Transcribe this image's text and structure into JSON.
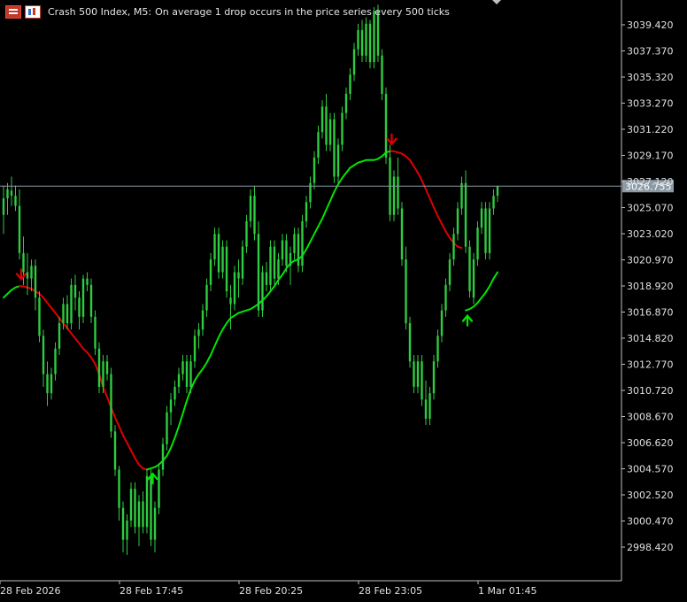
{
  "header": {
    "symbol": "Crash 500 Index, M5:",
    "description": "On average 1 drop occurs in the price series every 500 ticks",
    "icons": [
      "trade-panel-icon",
      "chart-icon"
    ]
  },
  "colors": {
    "background": "#000000",
    "candle": "#2ecc40",
    "ma_up": "#00e600",
    "ma_down": "#e00000",
    "current_price_line": "#8c9aa6",
    "price_label_bg": "#8c9aa6",
    "axis_text": "#e0e0e0",
    "axis_line": "#c0c0c0"
  },
  "chart_data": {
    "type": "candlestick",
    "title": "",
    "xlabel": "",
    "ylabel": "",
    "ylim": [
      2997.0,
      3041.0
    ],
    "y_ticks": [
      "3039.420",
      "3037.370",
      "3035.320",
      "3033.270",
      "3031.220",
      "3029.170",
      "3027.120",
      "3025.070",
      "3023.020",
      "3020.970",
      "3018.920",
      "3016.870",
      "3014.820",
      "3012.770",
      "3010.720",
      "3008.670",
      "3006.620",
      "3004.570",
      "3002.520",
      "3000.470",
      "2998.420"
    ],
    "x_ticks": [
      "28 Feb 2026",
      "28 Feb 17:45",
      "28 Feb 20:25",
      "28 Feb 23:05",
      "1 Mar 01:45"
    ],
    "x_tick_index": [
      0,
      30,
      60,
      90,
      120
    ],
    "current_price": "3026.755",
    "candles": [
      [
        3024.5,
        3026.8,
        3023.0,
        3025.8
      ],
      [
        3025.8,
        3027.0,
        3024.5,
        3026.5
      ],
      [
        3026.4,
        3027.5,
        3025.2,
        3026.0
      ],
      [
        3026.0,
        3026.8,
        3024.8,
        3025.2
      ],
      [
        3025.2,
        3026.5,
        3021.0,
        3021.5
      ],
      [
        3021.5,
        3022.8,
        3019.0,
        3020.0
      ],
      [
        3020.0,
        3021.5,
        3018.2,
        3019.5
      ],
      [
        3019.5,
        3021.0,
        3018.5,
        3020.5
      ],
      [
        3020.5,
        3021.0,
        3017.0,
        3018.0
      ],
      [
        3018.0,
        3018.5,
        3014.5,
        3015.0
      ],
      [
        3015.0,
        3015.5,
        3011.0,
        3012.0
      ],
      [
        3012.0,
        3013.0,
        3009.5,
        3010.5
      ],
      [
        3010.5,
        3012.5,
        3010.0,
        3012.0
      ],
      [
        3012.0,
        3014.5,
        3011.5,
        3014.0
      ],
      [
        3014.0,
        3016.5,
        3013.5,
        3016.0
      ],
      [
        3016.0,
        3018.0,
        3015.5,
        3017.5
      ],
      [
        3017.5,
        3018.2,
        3015.5,
        3016.0
      ],
      [
        3016.0,
        3019.5,
        3015.5,
        3019.0
      ],
      [
        3019.0,
        3019.8,
        3017.0,
        3018.0
      ],
      [
        3018.0,
        3018.5,
        3015.5,
        3016.5
      ],
      [
        3016.5,
        3019.8,
        3016.0,
        3019.5
      ],
      [
        3019.5,
        3020.0,
        3018.5,
        3019.0
      ],
      [
        3019.0,
        3019.5,
        3016.0,
        3016.5
      ],
      [
        3016.5,
        3017.0,
        3013.5,
        3014.0
      ],
      [
        3014.0,
        3014.5,
        3010.5,
        3011.0
      ],
      [
        3011.0,
        3013.5,
        3010.5,
        3013.0
      ],
      [
        3013.0,
        3013.5,
        3011.5,
        3012.0
      ],
      [
        3012.0,
        3012.5,
        3007.0,
        3007.5
      ],
      [
        3007.5,
        3008.0,
        3004.0,
        3004.5
      ],
      [
        3004.5,
        3004.8,
        3000.5,
        3001.5
      ],
      [
        3001.5,
        3002.0,
        2998.0,
        2999.0
      ],
      [
        2999.0,
        3001.0,
        2997.8,
        3000.5
      ],
      [
        3000.5,
        3003.5,
        3000.0,
        3003.0
      ],
      [
        3003.0,
        3003.5,
        2999.5,
        3000.0
      ],
      [
        3000.0,
        3002.5,
        2998.5,
        3002.0
      ],
      [
        3002.0,
        3002.8,
        2999.5,
        3000.0
      ],
      [
        3000.0,
        3004.5,
        2999.5,
        3004.0
      ],
      [
        3004.0,
        3004.5,
        2998.5,
        2999.0
      ],
      [
        2999.0,
        3002.0,
        2998.0,
        3001.5
      ],
      [
        3001.5,
        3005.0,
        3001.0,
        3004.5
      ],
      [
        3004.5,
        3007.0,
        3004.0,
        3006.5
      ],
      [
        3006.5,
        3009.5,
        3006.0,
        3009.0
      ],
      [
        3009.0,
        3010.5,
        3008.0,
        3010.0
      ],
      [
        3010.0,
        3011.5,
        3009.5,
        3011.0
      ],
      [
        3011.0,
        3012.5,
        3010.5,
        3012.0
      ],
      [
        3012.0,
        3013.5,
        3011.5,
        3013.0
      ],
      [
        3013.0,
        3013.5,
        3010.5,
        3011.0
      ],
      [
        3011.0,
        3013.5,
        3010.5,
        3013.0
      ],
      [
        3013.0,
        3015.5,
        3012.5,
        3015.0
      ],
      [
        3015.0,
        3016.0,
        3014.0,
        3015.5
      ],
      [
        3015.5,
        3017.5,
        3015.0,
        3017.0
      ],
      [
        3017.0,
        3019.5,
        3016.5,
        3019.0
      ],
      [
        3019.0,
        3021.5,
        3018.5,
        3021.0
      ],
      [
        3021.0,
        3023.5,
        3020.5,
        3023.0
      ],
      [
        3023.0,
        3023.5,
        3019.5,
        3020.0
      ],
      [
        3020.0,
        3022.5,
        3019.5,
        3022.0
      ],
      [
        3022.0,
        3022.5,
        3018.0,
        3018.5
      ],
      [
        3018.0,
        3019.0,
        3015.5,
        3017.5
      ],
      [
        3017.5,
        3020.5,
        3017.0,
        3020.0
      ],
      [
        3020.0,
        3021.0,
        3018.0,
        3019.5
      ],
      [
        3019.5,
        3022.5,
        3019.0,
        3022.0
      ],
      [
        3022.0,
        3024.5,
        3021.5,
        3024.0
      ],
      [
        3024.0,
        3026.5,
        3023.5,
        3026.0
      ],
      [
        3026.0,
        3026.8,
        3022.5,
        3023.0
      ],
      [
        3023.0,
        3024.0,
        3016.5,
        3017.0
      ],
      [
        3017.0,
        3020.5,
        3016.5,
        3020.0
      ],
      [
        3020.0,
        3020.8,
        3018.5,
        3019.0
      ],
      [
        3019.0,
        3022.5,
        3018.5,
        3022.0
      ],
      [
        3022.0,
        3022.5,
        3019.0,
        3019.5
      ],
      [
        3019.5,
        3021.5,
        3019.0,
        3021.0
      ],
      [
        3021.0,
        3023.0,
        3020.5,
        3022.5
      ],
      [
        3022.5,
        3023.0,
        3020.0,
        3020.5
      ],
      [
        3020.5,
        3022.0,
        3019.0,
        3021.5
      ],
      [
        3021.5,
        3023.5,
        3021.0,
        3023.0
      ],
      [
        3023.0,
        3023.5,
        3020.0,
        3020.5
      ],
      [
        3020.5,
        3024.5,
        3020.0,
        3024.0
      ],
      [
        3024.0,
        3026.0,
        3023.5,
        3025.5
      ],
      [
        3025.5,
        3027.5,
        3025.0,
        3027.0
      ],
      [
        3027.0,
        3029.5,
        3026.5,
        3029.0
      ],
      [
        3029.0,
        3031.5,
        3028.5,
        3031.0
      ],
      [
        3031.0,
        3033.5,
        3030.5,
        3033.0
      ],
      [
        3033.0,
        3034.0,
        3029.5,
        3030.0
      ],
      [
        3030.0,
        3032.5,
        3029.5,
        3032.0
      ],
      [
        3032.0,
        3032.5,
        3027.0,
        3027.5
      ],
      [
        3027.5,
        3030.5,
        3027.0,
        3030.0
      ],
      [
        3030.0,
        3033.0,
        3029.5,
        3032.5
      ],
      [
        3032.5,
        3034.5,
        3032.0,
        3034.0
      ],
      [
        3034.0,
        3036.0,
        3033.5,
        3035.5
      ],
      [
        3035.5,
        3038.0,
        3035.0,
        3037.5
      ],
      [
        3037.5,
        3039.5,
        3037.0,
        3039.0
      ],
      [
        3039.0,
        3039.8,
        3036.5,
        3037.0
      ],
      [
        3037.0,
        3040.0,
        3036.5,
        3039.5
      ],
      [
        3039.5,
        3039.8,
        3036.0,
        3036.5
      ],
      [
        3036.5,
        3040.8,
        3036.0,
        3040.5
      ],
      [
        3040.5,
        3041.0,
        3036.5,
        3037.0
      ],
      [
        3037.0,
        3037.5,
        3033.5,
        3034.0
      ],
      [
        3034.0,
        3034.5,
        3028.5,
        3029.0
      ],
      [
        3029.0,
        3030.0,
        3024.0,
        3024.5
      ],
      [
        3024.5,
        3028.0,
        3024.0,
        3027.5
      ],
      [
        3027.5,
        3029.0,
        3024.5,
        3025.0
      ],
      [
        3025.0,
        3025.5,
        3020.5,
        3021.0
      ],
      [
        3021.0,
        3022.0,
        3015.5,
        3016.0
      ],
      [
        3016.0,
        3016.5,
        3012.5,
        3013.0
      ],
      [
        3013.0,
        3013.5,
        3010.5,
        3011.0
      ],
      [
        3011.0,
        3013.5,
        3010.5,
        3013.0
      ],
      [
        3013.0,
        3013.5,
        3009.5,
        3010.0
      ],
      [
        3010.0,
        3011.5,
        3008.0,
        3008.5
      ],
      [
        3008.5,
        3011.0,
        3008.0,
        3010.5
      ],
      [
        3010.5,
        3013.5,
        3010.0,
        3013.0
      ],
      [
        3013.0,
        3015.5,
        3012.5,
        3015.0
      ],
      [
        3015.0,
        3017.5,
        3014.5,
        3017.0
      ],
      [
        3017.0,
        3019.5,
        3016.5,
        3019.0
      ],
      [
        3019.0,
        3021.5,
        3018.5,
        3021.0
      ],
      [
        3021.0,
        3023.5,
        3020.5,
        3023.0
      ],
      [
        3023.0,
        3025.5,
        3022.5,
        3025.0
      ],
      [
        3025.0,
        3027.5,
        3024.5,
        3027.0
      ],
      [
        3027.0,
        3028.0,
        3021.5,
        3022.0
      ],
      [
        3022.0,
        3022.5,
        3018.0,
        3018.5
      ],
      [
        3018.0,
        3021.5,
        3017.5,
        3021.0
      ],
      [
        3021.0,
        3024.0,
        3020.5,
        3023.5
      ],
      [
        3023.5,
        3025.5,
        3023.0,
        3025.0
      ],
      [
        3025.0,
        3025.5,
        3021.0,
        3021.5
      ],
      [
        3021.5,
        3025.5,
        3021.0,
        3025.0
      ],
      [
        3025.0,
        3026.5,
        3024.5,
        3026.0
      ],
      [
        3026.0,
        3026.8,
        3025.5,
        3026.755
      ]
    ],
    "ma": [
      3018.0,
      3018.3,
      3018.6,
      3018.8,
      3018.9,
      3018.9,
      3018.8,
      3018.7,
      3018.5,
      3018.3,
      3018.0,
      3017.6,
      3017.2,
      3016.8,
      3016.4,
      3016.0,
      3015.6,
      3015.2,
      3014.8,
      3014.4,
      3014.0,
      3013.7,
      3013.3,
      3012.8,
      3012.0,
      3011.0,
      3010.2,
      3009.4,
      3008.6,
      3007.9,
      3007.2,
      3006.6,
      3006.0,
      3005.4,
      3004.9,
      3004.6,
      3004.5,
      3004.6,
      3004.7,
      3004.9,
      3005.2,
      3005.6,
      3006.2,
      3007.0,
      3007.9,
      3008.9,
      3009.9,
      3010.8,
      3011.5,
      3012.0,
      3012.4,
      3012.9,
      3013.5,
      3014.2,
      3014.9,
      3015.5,
      3016.0,
      3016.4,
      3016.6,
      3016.8,
      3016.9,
      3017.0,
      3017.1,
      3017.3,
      3017.5,
      3017.8,
      3018.1,
      3018.5,
      3018.9,
      3019.4,
      3019.8,
      3020.3,
      3020.7,
      3020.9,
      3021.0,
      3021.3,
      3021.8,
      3022.4,
      3023.0,
      3023.6,
      3024.2,
      3024.9,
      3025.6,
      3026.3,
      3026.9,
      3027.4,
      3027.8,
      3028.2,
      3028.4,
      3028.6,
      3028.7,
      3028.8,
      3028.8,
      3028.8,
      3028.9,
      3029.1,
      3029.4,
      3029.5,
      3029.5,
      3029.4,
      3029.3,
      3029.1,
      3028.8,
      3028.3,
      3027.8,
      3027.2,
      3026.5,
      3025.8,
      3025.1,
      3024.4,
      3023.8,
      3023.2,
      3022.7,
      3022.3,
      3022.0,
      3021.9,
      3017.0,
      3017.1,
      3017.3,
      3017.6,
      3018.0,
      3018.4,
      3018.9,
      3019.5,
      3020.0
    ],
    "ma_color_segments": [
      {
        "from": 0,
        "to": 4,
        "color": "up"
      },
      {
        "from": 4,
        "to": 36,
        "color": "down"
      },
      {
        "from": 36,
        "to": 97,
        "color": "up"
      },
      {
        "from": 97,
        "to": 115,
        "color": "down"
      },
      {
        "from": 116,
        "to": 124,
        "color": "up"
      }
    ],
    "signals": [
      {
        "index": 4,
        "type": "sell"
      },
      {
        "index": 37,
        "type": "buy"
      },
      {
        "index": 97,
        "type": "sell"
      },
      {
        "index": 116,
        "type": "buy"
      }
    ]
  }
}
